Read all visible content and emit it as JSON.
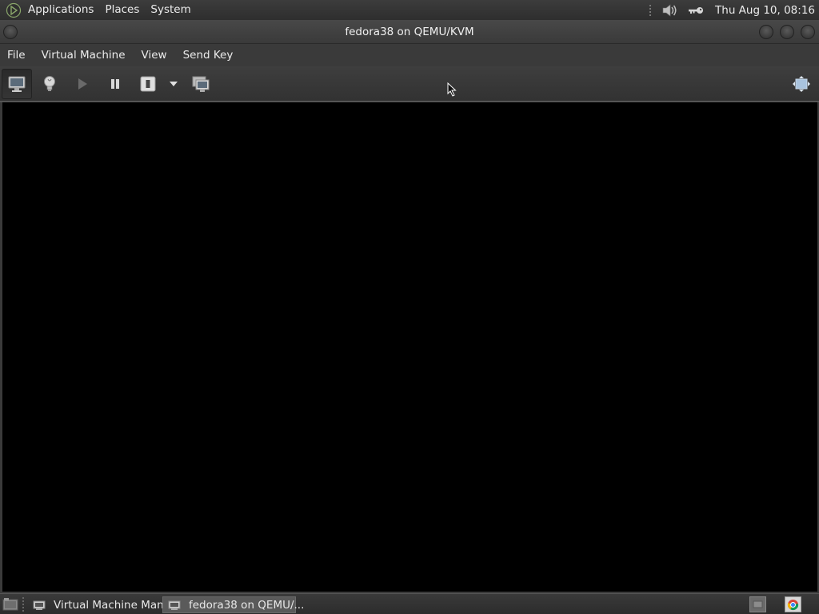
{
  "top_panel": {
    "menus": [
      "Applications",
      "Places",
      "System"
    ],
    "clock": "Thu Aug 10, 08:16",
    "icons": [
      "gnome-foot-icon",
      "volume-icon",
      "key-icon"
    ]
  },
  "window": {
    "title": "fedora38 on QEMU/KVM"
  },
  "menubar": {
    "items": [
      "File",
      "Virtual Machine",
      "View",
      "Send Key"
    ]
  },
  "toolbar": {
    "buttons": [
      "console-view",
      "details-view",
      "run",
      "pause",
      "shutdown",
      "shutdown-menu",
      "snapshots",
      "fullscreen"
    ]
  },
  "taskbar": {
    "tasks": [
      {
        "label": "Virtual Machine Man...",
        "active": false
      },
      {
        "label": "fedora38 on QEMU/...",
        "active": true
      }
    ]
  }
}
